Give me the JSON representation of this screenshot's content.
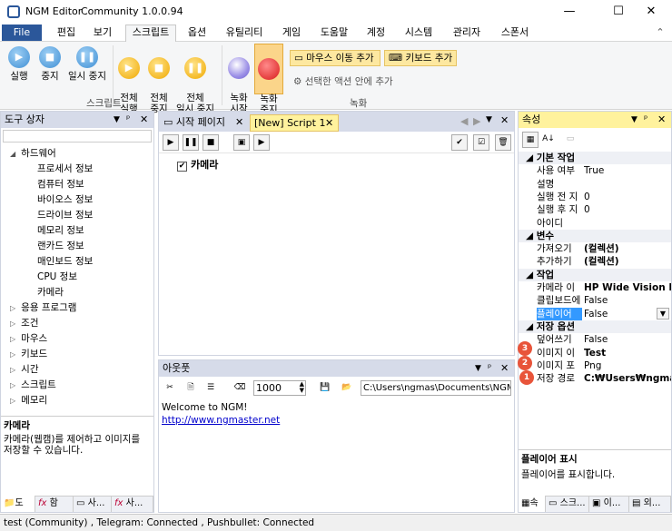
{
  "app": {
    "title": "NGM Editor",
    "subtitle": "Community 1.0.0.94"
  },
  "window": {
    "min": "—",
    "max": "☐",
    "close": "✕"
  },
  "menu": {
    "file": "File",
    "items": [
      "편집",
      "보기",
      "스크립트",
      "옵션",
      "유틸리티",
      "게임",
      "도움말",
      "계정",
      "시스템",
      "관리자",
      "스폰서"
    ],
    "collapse": "⌃"
  },
  "ribbon": {
    "run": "실행",
    "stop": "중지",
    "pause": "일시 중지",
    "run_all": "전체\n실행",
    "stop_all": "전체\n중지",
    "pause_all": "전체\n일시 중지",
    "group_script": "스크립트",
    "record_start": "녹화\n시작",
    "record_stop": "녹화\n중지",
    "mouse_move": "마우스 이동 추가",
    "keyboard_add": "키보드 추가",
    "add_selected": "선택한 액션 안에 추가",
    "group_record": "녹화"
  },
  "toolbox": {
    "title": "도구 상자",
    "pin": "ㅁ",
    "items": [
      {
        "label": "하드웨어",
        "level": 0,
        "expanded": true
      },
      {
        "label": "프로세서 정보",
        "level": 1
      },
      {
        "label": "컴퓨터 정보",
        "level": 1
      },
      {
        "label": "바이오스 정보",
        "level": 1
      },
      {
        "label": "드라이브 정보",
        "level": 1
      },
      {
        "label": "메모리 정보",
        "level": 1
      },
      {
        "label": "랜카드 정보",
        "level": 1
      },
      {
        "label": "매인보드 정보",
        "level": 1
      },
      {
        "label": "CPU 정보",
        "level": 1
      },
      {
        "label": "카메라",
        "level": 1
      },
      {
        "label": "응용 프로그램",
        "level": 0
      },
      {
        "label": "조건",
        "level": 0
      },
      {
        "label": "마우스",
        "level": 0
      },
      {
        "label": "키보드",
        "level": 0
      },
      {
        "label": "시간",
        "level": 0
      },
      {
        "label": "스크립트",
        "level": 0
      },
      {
        "label": "메모리",
        "level": 0
      }
    ],
    "desc_title": "카메라",
    "desc_text": "카메라(웹캠)를 제어하고 이미지를 저장할 수 있습니다.",
    "tabs": [
      "도",
      "함",
      "사...",
      "사..."
    ]
  },
  "editor": {
    "tabs": [
      "시작 페이지",
      "[New] Script 1"
    ],
    "line": "카메라"
  },
  "output": {
    "title": "아웃풋",
    "value": "1000",
    "path": "C:\\Users\\ngmas\\Documents\\NGM5\\",
    "welcome": "Welcome to NGM!",
    "link": "http://www.ngmaster.net"
  },
  "props": {
    "title": "속성",
    "sections": [
      {
        "name": "기본 작업",
        "rows": [
          [
            "사용 여부",
            "True"
          ],
          [
            "설명",
            ""
          ],
          [
            "실행 전 지",
            "0"
          ],
          [
            "실행 후 지",
            "0"
          ],
          [
            "아이디",
            ""
          ]
        ]
      },
      {
        "name": "변수",
        "rows": [
          [
            "가져오기",
            "(컬렉션)"
          ],
          [
            "추가하기",
            "(컬렉션)"
          ]
        ]
      },
      {
        "name": "작업",
        "rows": [
          [
            "카메라 이",
            "HP Wide Vision H"
          ],
          [
            "클립보드에",
            "False"
          ],
          [
            "플레이어",
            "False"
          ]
        ]
      },
      {
        "name": "저장 옵션",
        "rows": [
          [
            "덮어쓰기",
            "False"
          ],
          [
            "이미지 이",
            "Test"
          ],
          [
            "이미지 포",
            "Png"
          ],
          [
            "저장 경로",
            "C:₩Users₩ngma"
          ]
        ]
      }
    ],
    "desc_title": "플레이어 표시",
    "desc_text": "플레이어를 표시합니다.",
    "tabs": [
      "속",
      "스크...",
      "이...",
      "외..."
    ],
    "badges": [
      "3",
      "2",
      "1"
    ]
  },
  "status": "test (Community)  , Telegram: Connected  , Pushbullet: Connected"
}
